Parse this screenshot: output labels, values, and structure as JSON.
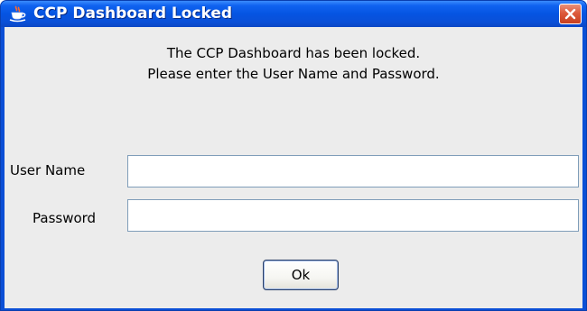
{
  "window": {
    "title": "CCP Dashboard Locked",
    "app_icon": "java-cup-icon",
    "close_icon": "close-icon",
    "titlebar_color": "#0554e2",
    "close_button_color": "#dd5a3c"
  },
  "message": {
    "line1": "The CCP Dashboard has been locked.",
    "line2": "Please enter the User Name and Password."
  },
  "form": {
    "username_label": "User Name",
    "username_value": "",
    "password_label": "Password",
    "password_value": ""
  },
  "buttons": {
    "ok_label": "Ok"
  }
}
